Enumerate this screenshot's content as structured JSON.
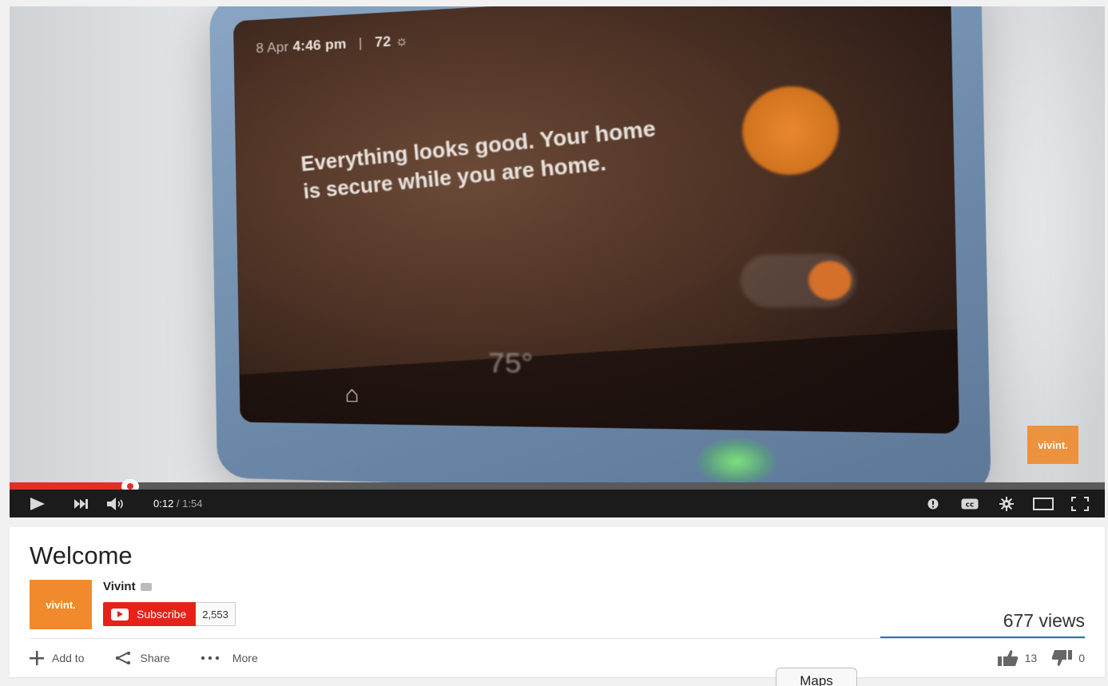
{
  "video": {
    "scene": {
      "status_date": "8 Apr",
      "status_time": "4:46 pm",
      "status_sep": "|",
      "status_temp": "72",
      "message": "Everything looks good. Your home is secure while you are home.",
      "thermostat": "75°"
    },
    "watermark": "vivint.",
    "progress": 0.11,
    "time_current": "0:12",
    "time_separator": " / ",
    "time_duration": "1:54"
  },
  "info": {
    "title": "Welcome",
    "channel_name": "Vivint",
    "avatar_text": "vivint.",
    "subscribe_label": "Subscribe",
    "subscriber_count": "2,553",
    "views": "677 views",
    "actions": {
      "add_to": "Add to",
      "share": "Share",
      "more": "More"
    },
    "likes": "13",
    "dislikes": "0"
  },
  "tooltip": "Maps",
  "colors": {
    "progress": "#e52d27",
    "subscribe": "#e62117",
    "brand_orange": "#f08a2c",
    "sentiment_bar": "#167ac6"
  },
  "icons": [
    "play-icon",
    "next-icon",
    "volume-icon",
    "annotations-icon",
    "captions-icon",
    "settings-icon",
    "theater-icon",
    "fullscreen-icon",
    "plus-icon",
    "share-icon",
    "more-icon",
    "thumbs-up-icon",
    "thumbs-down-icon",
    "verified-icon",
    "youtube-logo-icon",
    "home-icon",
    "sun-icon"
  ]
}
